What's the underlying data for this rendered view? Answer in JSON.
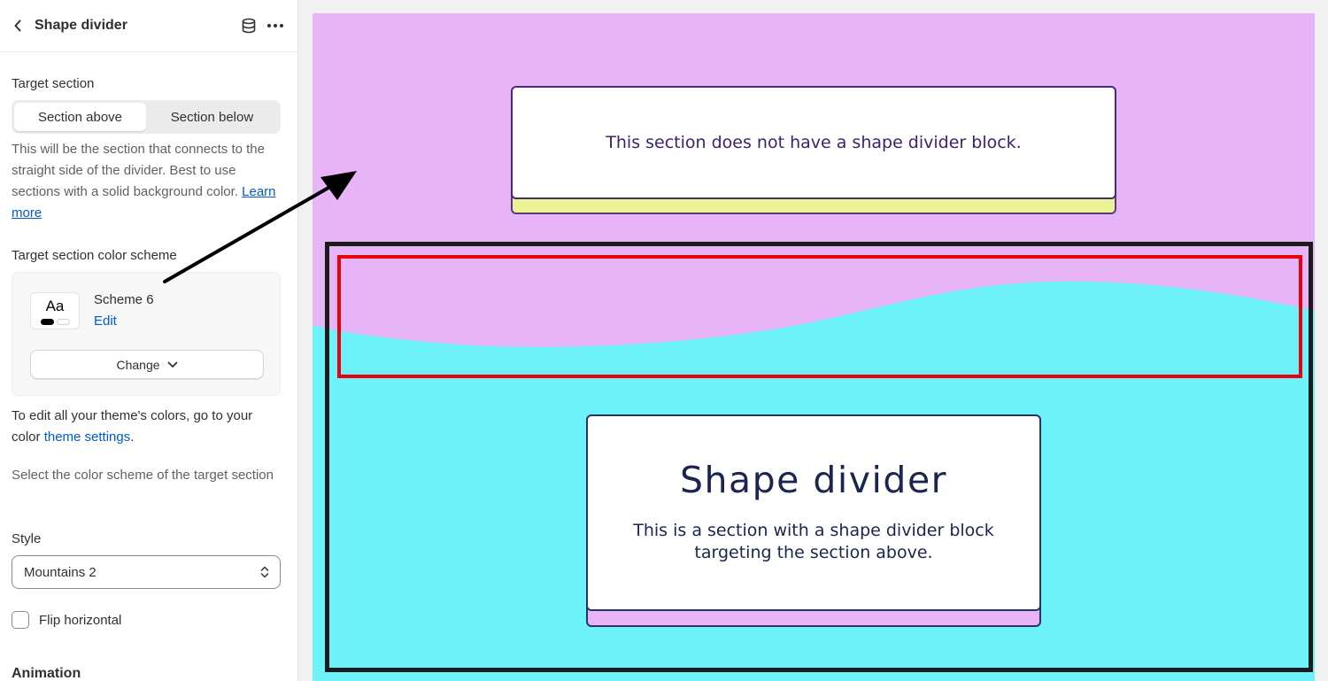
{
  "header": {
    "title": "Shape divider",
    "back_icon": "chevron-left-icon",
    "database_icon": "database-icon",
    "more_icon": "more-horizontal-icon"
  },
  "target_section": {
    "label": "Target section",
    "options": [
      "Section above",
      "Section below"
    ],
    "selected": "Section above",
    "help_text": "This will be the section that connects to the straight side of the divider. Best to use sections with a solid background color.",
    "help_link": "Learn more"
  },
  "color_scheme": {
    "label": "Target section color scheme",
    "swatch_text": "Aa",
    "scheme_name": "Scheme 6",
    "edit_label": "Edit",
    "change_label": "Change",
    "note_prefix": "To edit all your theme's colors, go to your color ",
    "note_link": "theme settings",
    "note_suffix": ".",
    "description": "Select the color scheme of the target section"
  },
  "style": {
    "label": "Style",
    "value": "Mountains 2"
  },
  "flip": {
    "label": "Flip horizontal",
    "checked": false
  },
  "animation": {
    "label": "Animation"
  },
  "preview": {
    "top_section_text": "This section does not have a shape divider block.",
    "bottom_title": "Shape divider",
    "bottom_body": "This is a section with a shape divider block targeting the section above.",
    "colors": {
      "top_bg": "#e8b4f8",
      "bottom_bg": "#6ef2fa",
      "highlight_red": "#e8000b",
      "highlight_black": "#1b1b1b",
      "link_blue": "#005bd3"
    }
  }
}
